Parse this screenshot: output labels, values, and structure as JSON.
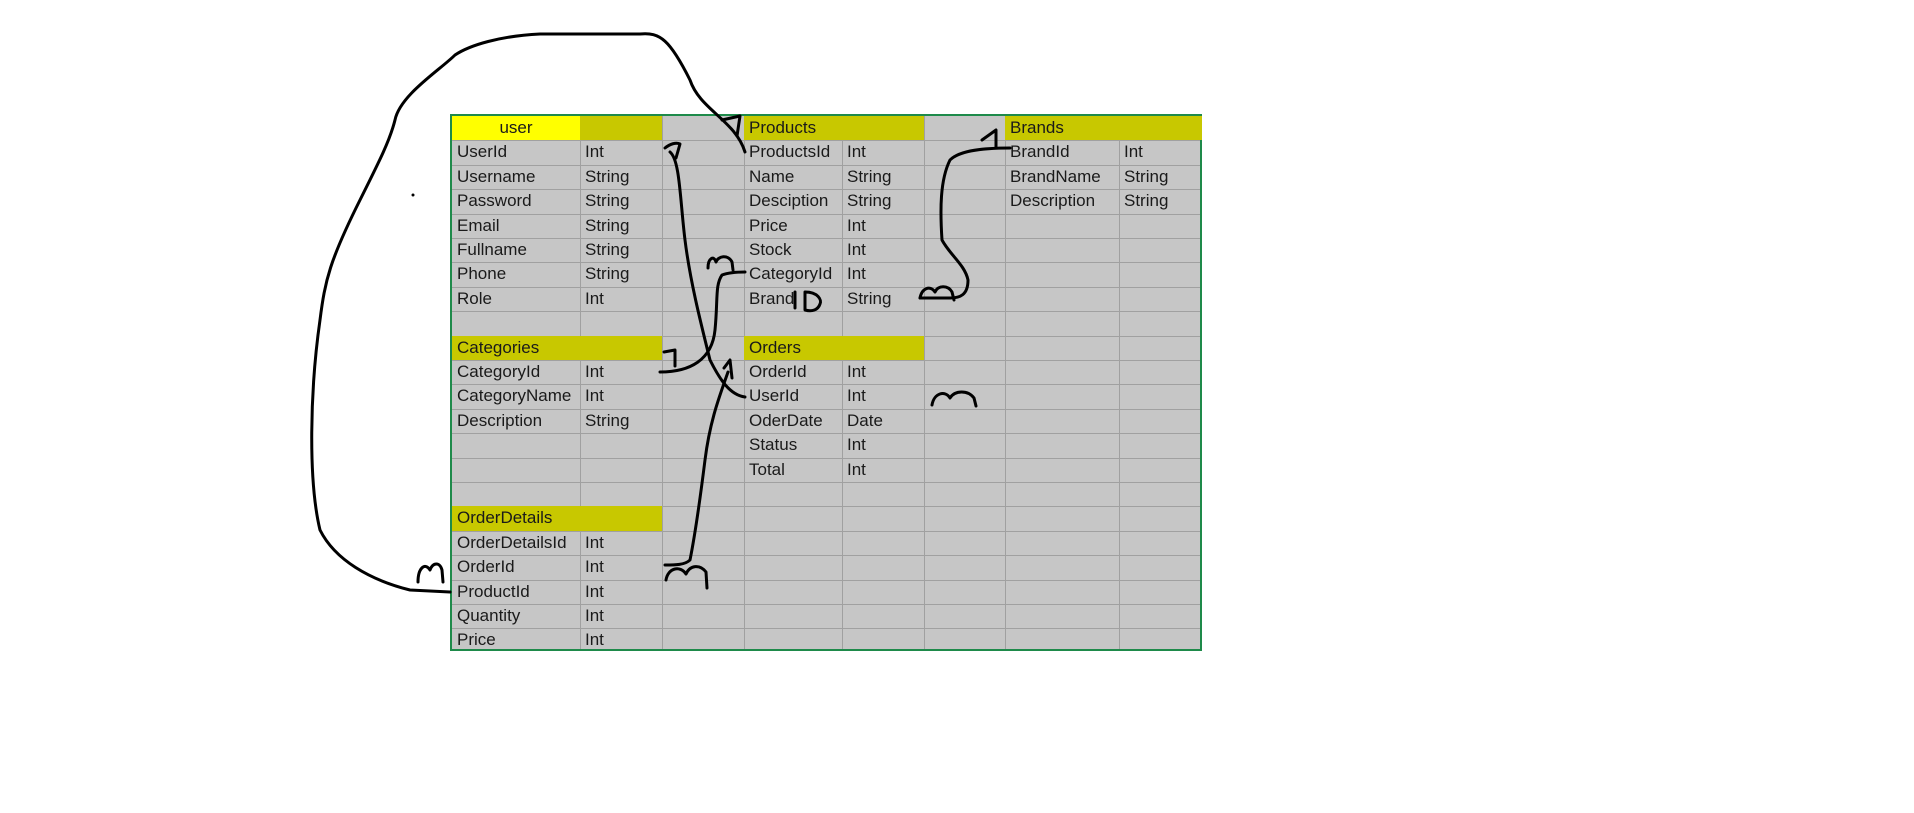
{
  "tables": [
    {
      "id": "user",
      "title": "user",
      "bright": true,
      "header_pad": true,
      "rows": [
        [
          "UserId",
          "Int"
        ],
        [
          "Username",
          "String"
        ],
        [
          "Password",
          "String"
        ],
        [
          "Email",
          "String"
        ],
        [
          "Fullname",
          "String"
        ],
        [
          "Phone",
          "String"
        ],
        [
          "Role",
          "Int"
        ]
      ]
    },
    {
      "id": "products",
      "title": "Products",
      "rows": [
        [
          "ProductsId",
          "Int"
        ],
        [
          "Name",
          "String"
        ],
        [
          "Desciption",
          "String"
        ],
        [
          "Price",
          "Int"
        ],
        [
          "Stock",
          "Int"
        ],
        [
          "CategoryId",
          "Int"
        ],
        [
          "Brand",
          "String"
        ]
      ]
    },
    {
      "id": "brands",
      "title": "Brands",
      "rows": [
        [
          "BrandId",
          "Int"
        ],
        [
          "BrandName",
          "String"
        ],
        [
          "Description",
          "String"
        ]
      ]
    },
    {
      "id": "categories",
      "title": "Categories",
      "rows": [
        [
          "CategoryId",
          "Int"
        ],
        [
          "CategoryName",
          "Int"
        ],
        [
          "Description",
          "String"
        ]
      ]
    },
    {
      "id": "orders",
      "title": "Orders",
      "rows": [
        [
          "OrderId",
          "Int"
        ],
        [
          "UserId",
          "Int"
        ],
        [
          "OderDate",
          "Date"
        ],
        [
          "Status",
          "Int"
        ],
        [
          "Total",
          "Int"
        ]
      ]
    },
    {
      "id": "orderdetails",
      "title": "OrderDetails",
      "rows": [
        [
          "OrderDetailsId",
          "Int"
        ],
        [
          "OrderId",
          "Int"
        ],
        [
          "ProductId",
          "Int"
        ],
        [
          "Quantity",
          "Int"
        ],
        [
          "Price",
          "Int"
        ]
      ]
    }
  ],
  "handwriting": {
    "brand_suffix": "ID",
    "one_label": "1",
    "many_label": "n"
  },
  "colors": {
    "header": "#c8c800",
    "header_bright": "#ffff00",
    "cell": "#c6c6c6",
    "border": "#1e8a4a",
    "ink": "#000000"
  }
}
